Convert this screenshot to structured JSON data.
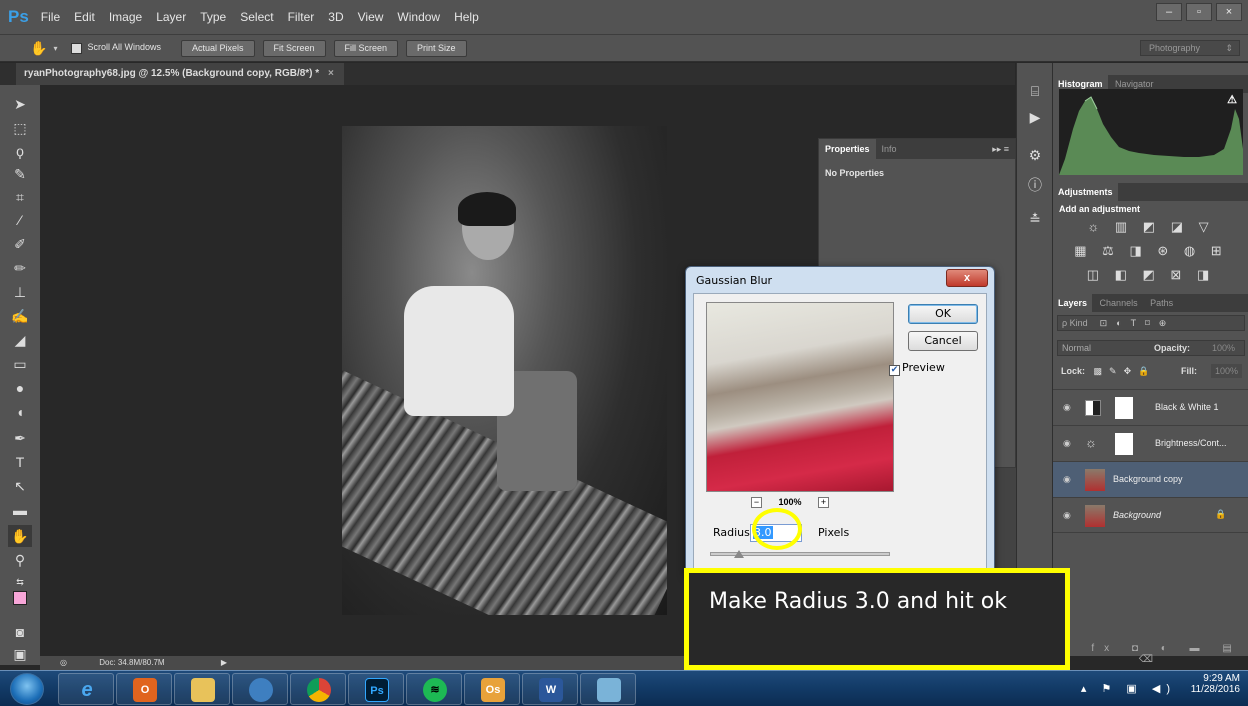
{
  "app": {
    "logo": "Ps",
    "menu": [
      "File",
      "Edit",
      "Image",
      "Layer",
      "Type",
      "Select",
      "Filter",
      "3D",
      "View",
      "Window",
      "Help"
    ],
    "window_controls": [
      "–",
      "▫",
      "×"
    ]
  },
  "options_bar": {
    "scroll_all_windows": "Scroll All Windows",
    "actual_pixels": "Actual Pixels",
    "fit_screen": "Fit Screen",
    "fill_screen": "Fill Screen",
    "print_size": "Print Size",
    "workspace": "Photography"
  },
  "document": {
    "tab_title": "ryanPhotography68.jpg @ 12.5% (Background copy, RGB/8*) *",
    "tab_close": "×",
    "doc_size": "Doc: 34.8M/80.7M"
  },
  "properties_panel": {
    "tabs": [
      "Properties",
      "Info"
    ],
    "content": "No Properties"
  },
  "histogram_panel": {
    "tabs": [
      "Histogram",
      "Navigator"
    ]
  },
  "adjustments_panel": {
    "tab": "Adjustments",
    "heading": "Add an adjustment",
    "row1": "☼ ▥ ◩ ◪ ▽",
    "row2": "▦ ⚖ ◨ ⊛ ◍ ⊞",
    "row3": "◫ ◧ ◩ ⊠ ◨"
  },
  "layers_panel": {
    "tabs": [
      "Layers",
      "Channels",
      "Paths"
    ],
    "kind": "ρ Kind",
    "blend_mode": "Normal",
    "opacity_label": "Opacity:",
    "opacity_value": "100%",
    "lock_label": "Lock:",
    "fill_label": "Fill:",
    "fill_value": "100%",
    "layers": [
      {
        "name": "Black & White 1"
      },
      {
        "name": "Brightness/Cont..."
      },
      {
        "name": "Background copy"
      },
      {
        "name": "Background"
      }
    ],
    "footer": "⊕ fx ◘ ◐ ▬ ▤ ⌫"
  },
  "dialog": {
    "title": "Gaussian Blur",
    "close": "x",
    "ok": "OK",
    "cancel": "Cancel",
    "preview_label": "Preview",
    "preview_checked": true,
    "zoom": "100%",
    "zoom_out": "−",
    "zoom_in": "+",
    "radius_label": "Radius:",
    "radius_value": "3.0",
    "units": "Pixels"
  },
  "annotation": {
    "text": "Make Radius 3.0 and hit ok",
    "color": "#ffff00"
  },
  "taskbar": {
    "apps": [
      "internet-explorer",
      "office",
      "file-explorer",
      "media-player",
      "chrome",
      "photoshop",
      "spotify",
      "outlook",
      "word",
      "photo-viewer"
    ],
    "time": "9:29 AM",
    "date": "11/28/2016"
  }
}
